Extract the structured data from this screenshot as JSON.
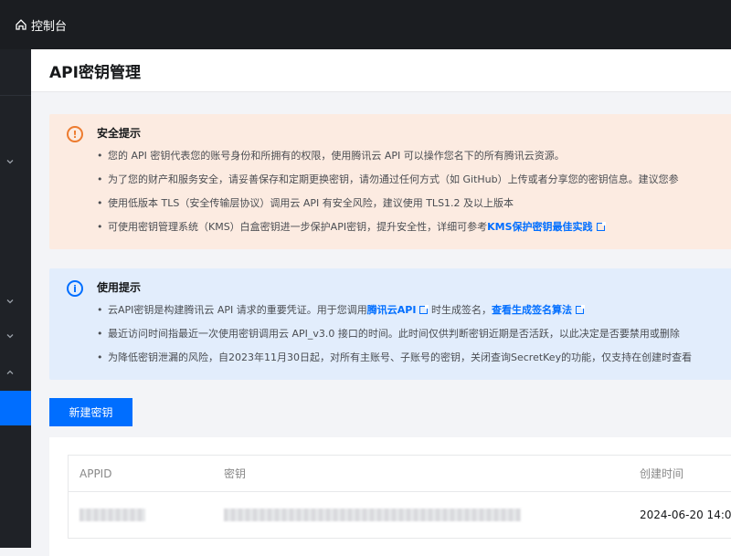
{
  "topbar": {
    "console_label": "控制台"
  },
  "header": {
    "title": "API密钥管理"
  },
  "security_notice": {
    "title": "安全提示",
    "items": [
      "您的 API 密钥代表您的账号身份和所拥有的权限，使用腾讯云 API 可以操作您名下的所有腾讯云资源。",
      "为了您的财产和服务安全，请妥善保存和定期更换密钥，请勿通过任何方式（如 GitHub）上传或者分享您的密钥信息。建议您参",
      "使用低版本 TLS（安全传输层协议）调用云 API 有安全风险，建议使用 TLS1.2 及以上版本"
    ],
    "kms_prefix": "可使用密钥管理系统（KMS）白盒密钥进一步保护API密钥，提升安全性，详细可参考",
    "kms_link": "KMS保护密钥最佳实践"
  },
  "usage_notice": {
    "title": "使用提示",
    "item1_prefix": "云API密钥是构建腾讯云 API 请求的重要凭证。用于您调用",
    "item1_link1": "腾讯云API",
    "item1_middle": " 时生成签名，",
    "item1_link2": "查看生成签名算法",
    "item2": "最近访问时间指最近一次使用密钥调用云 API_v3.0 接口的时间。此时间仅供判断密钥近期是否活跃，以此决定是否要禁用或删除",
    "item3": "为降低密钥泄漏的风险，自2023年11月30日起，对所有主账号、子账号的密钥，关闭查询SecretKey的功能，仅支持在创建时查看"
  },
  "create_button": "新建密钥",
  "table": {
    "columns": [
      "APPID",
      "密钥",
      "创建时间"
    ],
    "rows": [
      {
        "appid": "",
        "key": "",
        "created": "2024-06-20 14:0"
      }
    ]
  },
  "colors": {
    "accent": "#006eff",
    "warning": "#ed7b2f",
    "warning_bg": "#fcebe1",
    "info_bg": "#e2edfc",
    "topbar_bg": "#1b1d21"
  }
}
